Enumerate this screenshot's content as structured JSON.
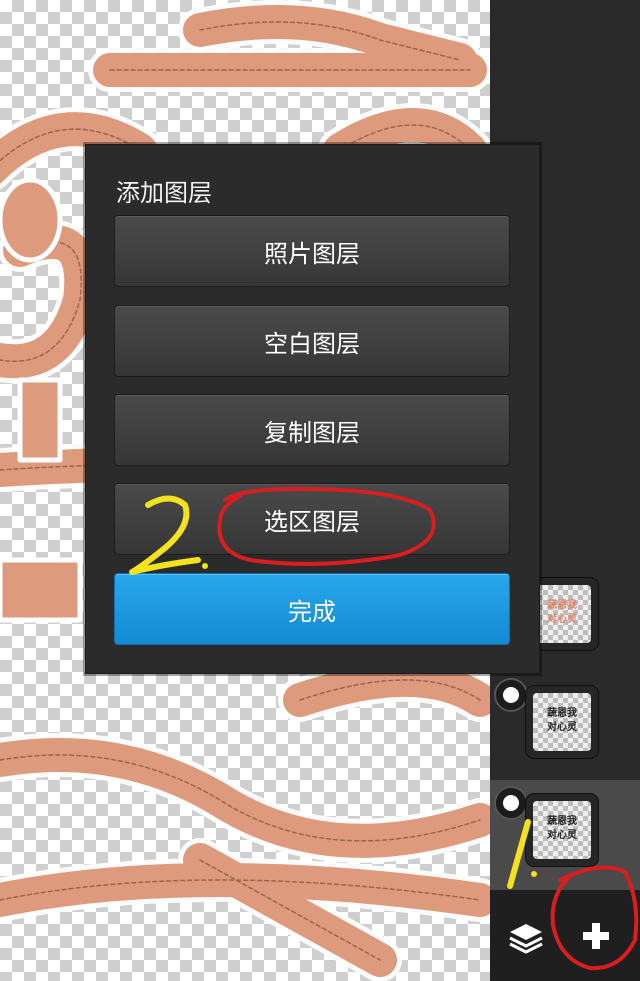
{
  "dialog": {
    "title": "添加图层",
    "buttons": [
      {
        "label": "照片图层"
      },
      {
        "label": "空白图层"
      },
      {
        "label": "复制图层"
      },
      {
        "label": "选区图层"
      }
    ],
    "done_label": "完成"
  },
  "layer_panel": {
    "thumbnails": [
      {
        "text": "蔬恩我\n对心灵",
        "style": "orange"
      },
      {
        "text": "蔬恩我\n对心灵",
        "style": "dark"
      },
      {
        "text": "蔬恩我\n对心灵",
        "style": "dark",
        "selected": true
      }
    ],
    "add_icon": "plus-icon",
    "layers_icon": "layers-icon"
  },
  "annotations": {
    "step1_text": "1.",
    "step2_text": "2.",
    "step1_color": "#f4e21c",
    "circle_color": "#d81e1e"
  },
  "colors": {
    "accent": "#1a98e2",
    "artwork": "#dd9a7c"
  }
}
